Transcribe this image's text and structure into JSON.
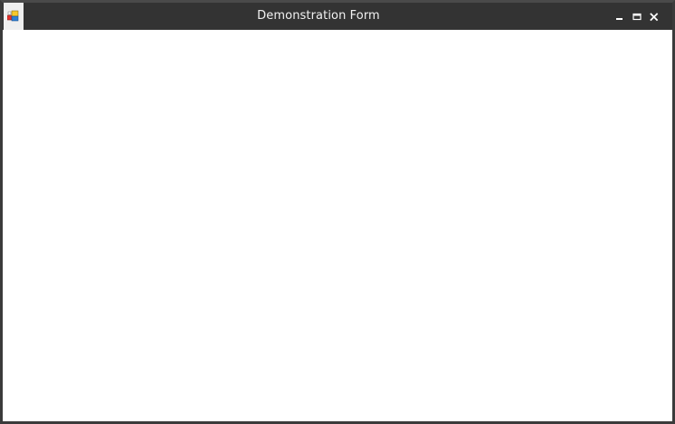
{
  "window": {
    "title": "Demonstration Form",
    "titlebar_color": "#333333",
    "border_color": "#3b3b3b",
    "client_background": "#ffffff"
  },
  "app_icon": {
    "name": "windows-form-icon",
    "colors": [
      "#e8322d",
      "#f7c82b",
      "#2f7fd3"
    ]
  },
  "controls": [
    {
      "id": "minimize",
      "icon": "minimize-icon"
    },
    {
      "id": "maximize",
      "icon": "maximize-icon"
    },
    {
      "id": "close",
      "icon": "close-icon"
    }
  ]
}
